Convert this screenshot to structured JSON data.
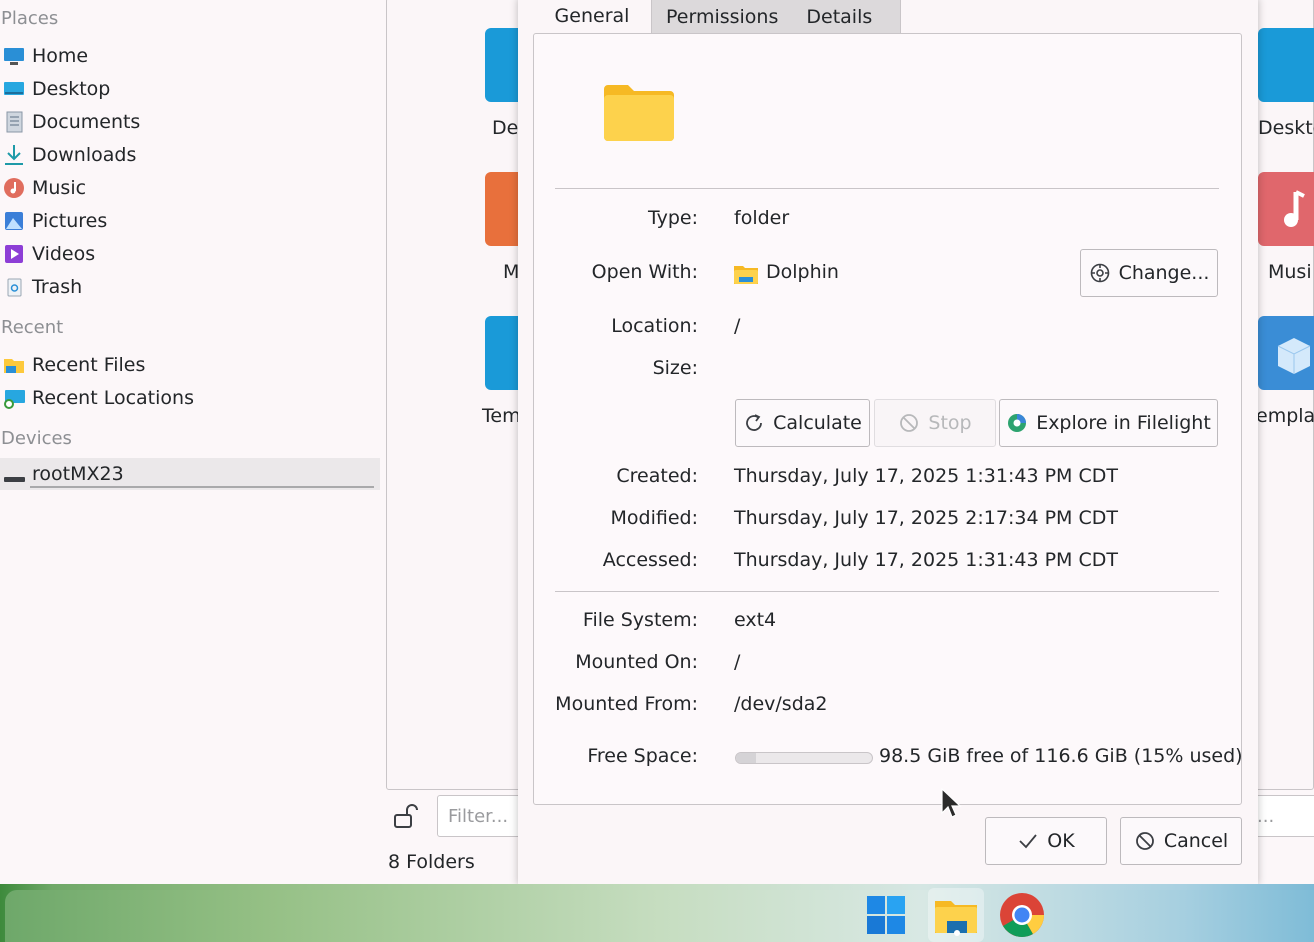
{
  "sidebar": {
    "places_title": "Places",
    "places": [
      {
        "label": "Home",
        "icon": "home-icon"
      },
      {
        "label": "Desktop",
        "icon": "desktop-icon"
      },
      {
        "label": "Documents",
        "icon": "documents-icon"
      },
      {
        "label": "Downloads",
        "icon": "downloads-icon"
      },
      {
        "label": "Music",
        "icon": "music-icon"
      },
      {
        "label": "Pictures",
        "icon": "pictures-icon"
      },
      {
        "label": "Videos",
        "icon": "videos-icon"
      },
      {
        "label": "Trash",
        "icon": "trash-icon"
      }
    ],
    "recent_title": "Recent",
    "recent": [
      {
        "label": "Recent Files",
        "icon": "recent-files-icon"
      },
      {
        "label": "Recent Locations",
        "icon": "recent-locations-icon"
      }
    ],
    "devices_title": "Devices",
    "devices": [
      {
        "label": "rootMX23",
        "icon": "drive-icon"
      }
    ]
  },
  "background": {
    "folder_labels": [
      "De",
      "M",
      "Tem",
      "Deskto",
      "Musi",
      "empla"
    ],
    "filter_placeholder": "Filter...",
    "filter_right_text": "...",
    "status": "8 Folders"
  },
  "dialog": {
    "tabs": [
      "General",
      "Permissions",
      "Details"
    ],
    "active_tab": "General",
    "rows": {
      "type_label": "Type:",
      "type_value": "folder",
      "open_with_label": "Open With:",
      "open_with_value": "Dolphin",
      "change_button": "Change...",
      "location_label": "Location:",
      "location_value": "/",
      "size_label": "Size:",
      "calculate_button": "Calculate",
      "stop_button": "Stop",
      "explore_button": "Explore in Filelight",
      "created_label": "Created:",
      "created_value": "Thursday, July 17, 2025 1:31:43 PM CDT",
      "modified_label": "Modified:",
      "modified_value": "Thursday, July 17, 2025 2:17:34 PM CDT",
      "accessed_label": "Accessed:",
      "accessed_value": "Thursday, July 17, 2025 1:31:43 PM CDT",
      "filesystem_label": "File System:",
      "filesystem_value": "ext4",
      "mounted_on_label": "Mounted On:",
      "mounted_on_value": "/",
      "mounted_from_label": "Mounted From:",
      "mounted_from_value": "/dev/sda2",
      "free_space_label": "Free Space:",
      "free_space_value": "98.5 GiB free of 116.6 GiB (15% used)",
      "used_fraction": 0.15
    },
    "ok_button": "OK",
    "cancel_button": "Cancel"
  },
  "taskbar": {
    "items": [
      "start-menu-icon",
      "file-manager-icon",
      "chrome-icon"
    ]
  },
  "colors": {
    "folder_yellow": "#fdd24c",
    "selection": "#ebe8ea",
    "border": "#c9c5c8"
  }
}
